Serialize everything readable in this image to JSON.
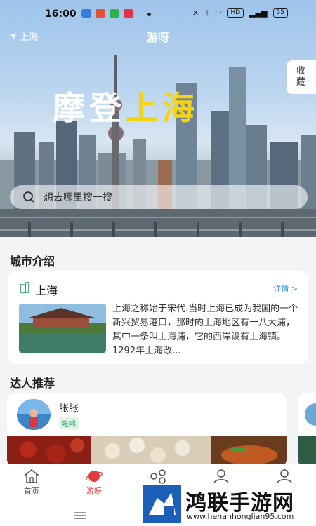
{
  "status": {
    "time": "16:00",
    "battery": "55",
    "hd": "HD"
  },
  "header": {
    "location": "上海",
    "title": "游呀",
    "favorite": "收藏"
  },
  "hero": {
    "title_white": "摩登",
    "title_yellow": "上海"
  },
  "search": {
    "placeholder": "想去哪里搜一搜"
  },
  "city_intro": {
    "section_title": "城市介绍",
    "city": "上海",
    "detail_link": "详情 >",
    "description": "上海之称始于宋代.当时上海已成为我国的一个新兴贸易港口，那时的上海地区有十八大浦，其中一条叫上海浦，它的西岸设有上海镇。1292年上海改..."
  },
  "experts": {
    "section_title": "达人推荐",
    "items": [
      {
        "name": "张张",
        "tag": "吃喝"
      }
    ]
  },
  "tabs": [
    {
      "label": "首页",
      "icon": "home-icon"
    },
    {
      "label": "游呀",
      "icon": "planet-icon",
      "active": true
    },
    {
      "label": "",
      "icon": "share-icon"
    },
    {
      "label": "",
      "icon": "user-icon"
    },
    {
      "label": "",
      "icon": "profile-icon"
    }
  ],
  "watermark": {
    "title": "鸿联手游网",
    "url": "www.henanhonglian95.com"
  },
  "colors": {
    "accent_red": "#e23b3b",
    "title_yellow": "#f5d315",
    "link_blue": "#2f8fd8",
    "tag_green": "#1e9a5c"
  }
}
